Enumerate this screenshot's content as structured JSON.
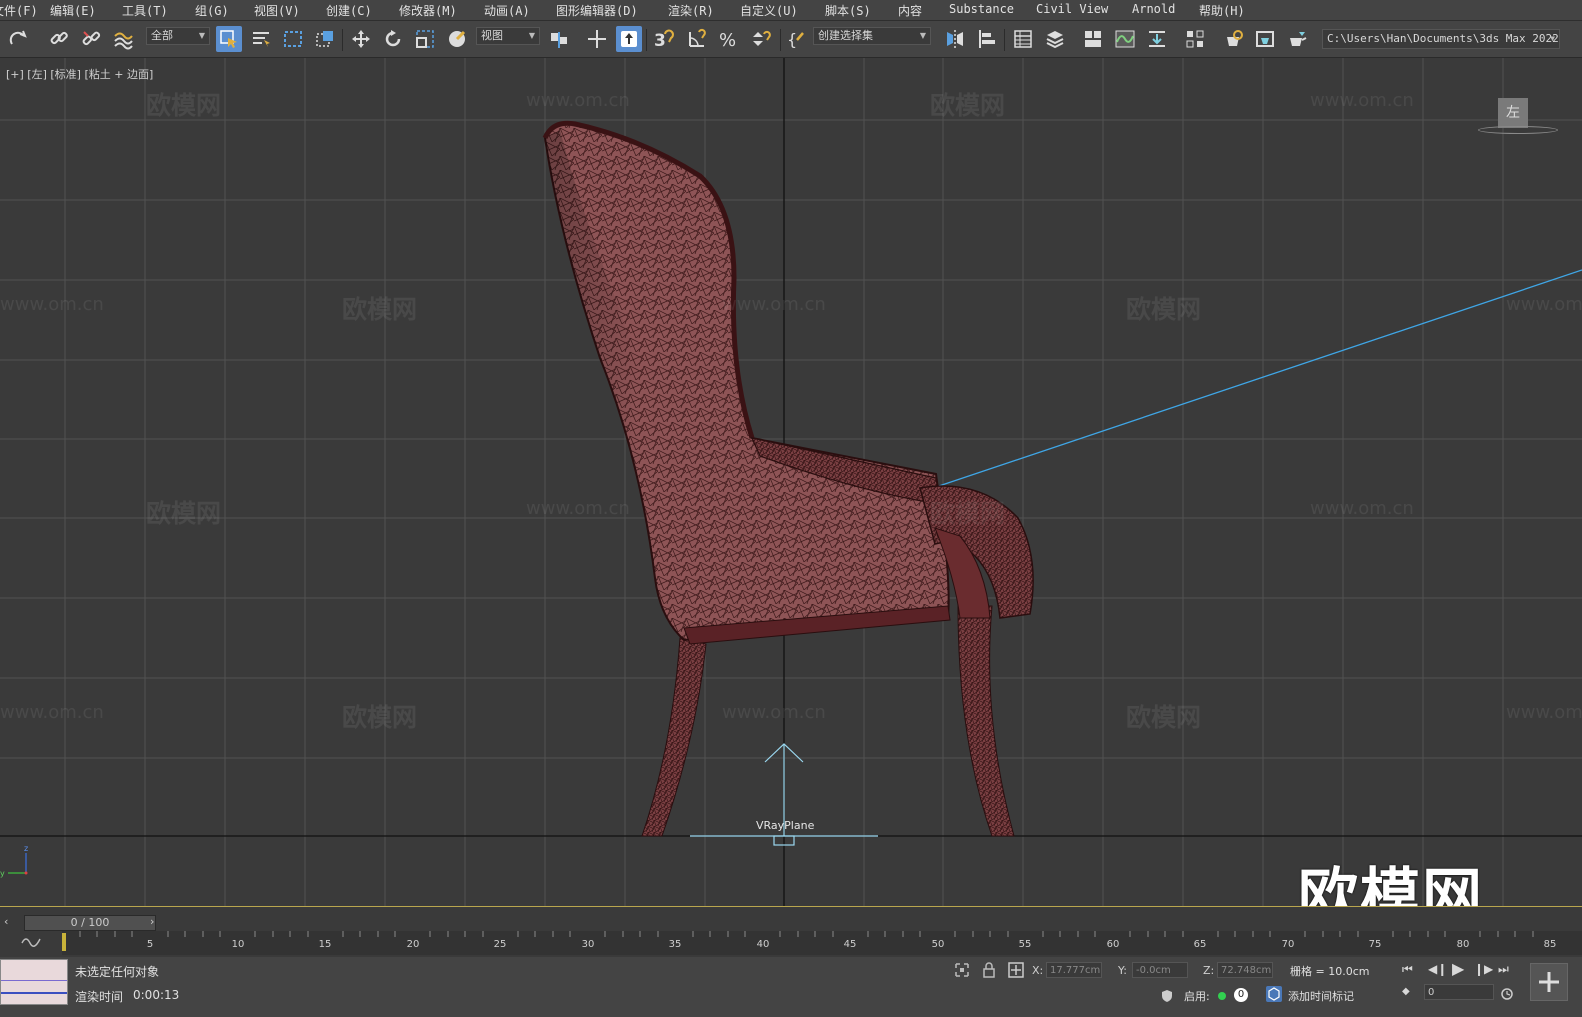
{
  "menu": [
    "文件(F)",
    "编辑(E)",
    "工具(T)",
    "组(G)",
    "视图(V)",
    "创建(C)",
    "修改器(M)",
    "动画(A)",
    "图形编辑器(D)",
    "渲染(R)",
    "自定义(U)",
    "脚本(S)",
    "内容",
    "Substance",
    "Civil View",
    "Arnold",
    "帮助(H)"
  ],
  "toolbar": {
    "selection_filter": "全部",
    "reference_coord": "视图",
    "named_selection": "创建选择集",
    "project_path": "C:\\Users\\Han\\Documents\\3ds Max 2022"
  },
  "viewport": {
    "label": "[+] [左] [标准] [粘土 + 边面]",
    "navcube_face": "左",
    "vrayplane_label": "VRayPlane",
    "watermark_cn": "欧模网",
    "watermark_url": "www.om.cn",
    "watermark_big": "欧模网"
  },
  "timeline": {
    "frame_display": "0 / 100",
    "ticks": [
      "5",
      "10",
      "15",
      "20",
      "25",
      "30",
      "35",
      "40",
      "45",
      "50",
      "55",
      "60",
      "65",
      "70",
      "75",
      "80",
      "85"
    ]
  },
  "status": {
    "selection": "未选定任何对象",
    "render_time_label": "渲染时间",
    "render_time_value": "0:00:13",
    "x_label": "X:",
    "x_value": "17.777cm",
    "y_label": "Y:",
    "y_value": "-0.0cm",
    "z_label": "Z:",
    "z_value": "72.748cm",
    "grid": "栅格 = 10.0cm",
    "enable_label": "启用:",
    "enable_count": "0",
    "add_time_tag": "添加时间标记",
    "frame_field": "0"
  },
  "colors": {
    "chair_fill": "#8e5456",
    "wire": "#3a1718",
    "accent_active": "#5b8fd0",
    "viewport_bg": "#3a3a3a",
    "grid_line": "#525252",
    "light_line": "#3fa6e6"
  }
}
